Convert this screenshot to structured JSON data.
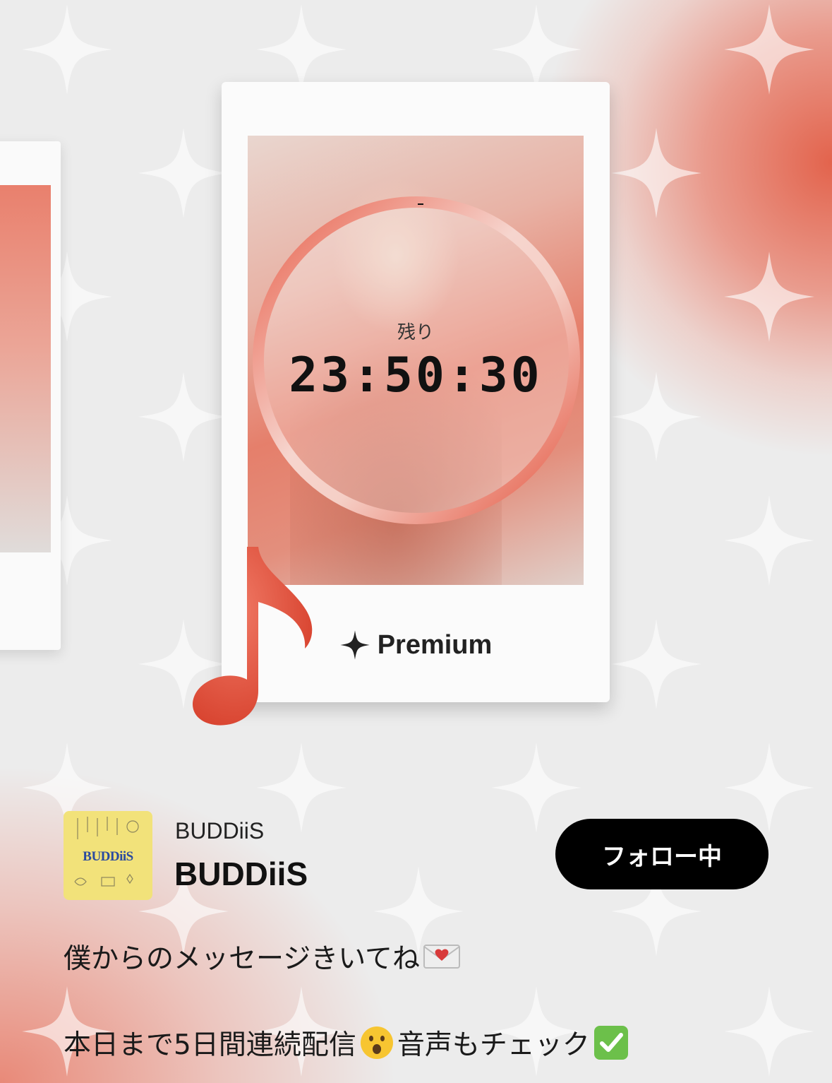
{
  "timer": {
    "label": "残り",
    "value": "23:50:30"
  },
  "card": {
    "badge": "Premium"
  },
  "artist": {
    "logo_text": "BUDDiiS",
    "account_label": "BUDDiiS",
    "name": "BUDDiiS",
    "follow_label": "フォロー中"
  },
  "caption": {
    "line1": "僕からのメッセージきいてね",
    "line2_a": "本日まで5日間連続配信",
    "line2_b": "音声もチェック"
  },
  "icons": {
    "badge": "sparkle-star-icon",
    "note": "musical-note-icon",
    "envelope": "love-letter-emoji",
    "surprised": "surprised-face-emoji",
    "check": "check-mark-button-emoji"
  },
  "colors": {
    "accent": "#e55a45",
    "follow_bg": "#000000"
  }
}
